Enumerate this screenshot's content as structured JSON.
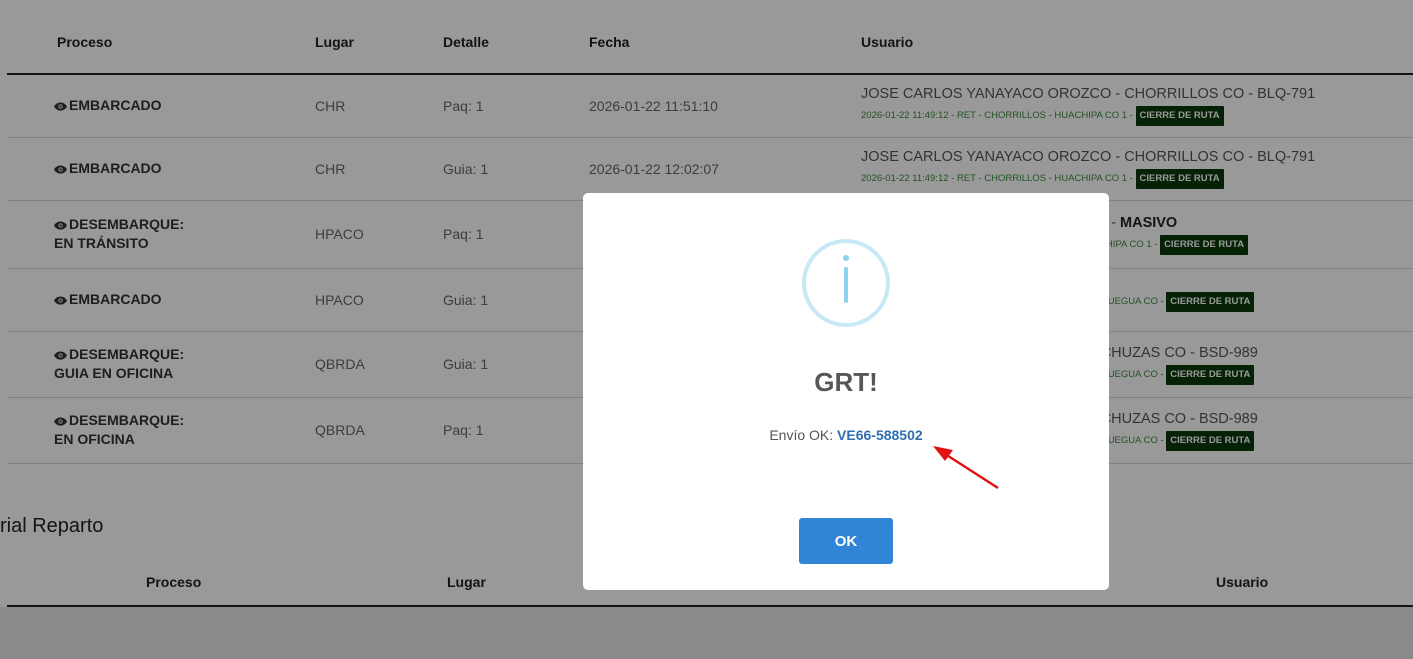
{
  "table": {
    "headers": {
      "proceso": "Proceso",
      "lugar": "Lugar",
      "detalle": "Detalle",
      "fecha": "Fecha",
      "usuario": "Usuario"
    },
    "rows": [
      {
        "proceso_line1": "EMBARCADO",
        "proceso_line2": "",
        "lugar": "CHR",
        "detalle": "Paq: 1",
        "fecha": "2026-01-22 11:51:10",
        "usuario": "JOSE CARLOS YANAYACO OROZCO - CHORRILLOS CO - BLQ-791",
        "usuario_bold": "",
        "sub": "2026-01-22 11:49:12 - RET - CHORRILLOS - HUACHIPA CO 1 - ",
        "badge": "CIERRE DE RUTA"
      },
      {
        "proceso_line1": "EMBARCADO",
        "proceso_line2": "",
        "lugar": "CHR",
        "detalle": "Guia: 1",
        "fecha": "2026-01-22 12:02:07",
        "usuario": "JOSE CARLOS YANAYACO OROZCO - CHORRILLOS CO - BLQ-791",
        "usuario_bold": "",
        "sub": "2026-01-22 11:49:12 - RET - CHORRILLOS - HUACHIPA CO 1 - ",
        "badge": "CIERRE DE RUTA"
      },
      {
        "proceso_line1": "DESEMBARQUE:",
        "proceso_line2": "EN TRÁNSITO",
        "lugar": "HPACO",
        "detalle": "Paq: 1",
        "fecha": "",
        "usuario": "91 - ",
        "usuario_bold": "MASIVO",
        "sub": "CHIPA CO 1 - ",
        "badge": "CIERRE DE RUTA"
      },
      {
        "proceso_line1": "EMBARCADO",
        "proceso_line2": "",
        "lugar": "HPACO",
        "detalle": "Guia: 1",
        "fecha": "",
        "usuario": "",
        "usuario_bold": "",
        "sub": "MOQUEGUA CO - ",
        "badge": "CIERRE DE RUTA"
      },
      {
        "proceso_line1": "DESEMBARQUE:",
        "proceso_line2": "GUIA EN OFICINA",
        "lugar": "QBRDA",
        "detalle": "Guia: 1",
        "fecha": "",
        "usuario": "ECHUZAS CO - BSD-989",
        "usuario_bold": "",
        "sub": "MOQUEGUA CO - ",
        "badge": "CIERRE DE RUTA"
      },
      {
        "proceso_line1": "DESEMBARQUE:",
        "proceso_line2": "EN OFICINA",
        "lugar": "QBRDA",
        "detalle": "Paq: 1",
        "fecha": "",
        "usuario": "ECHUZAS CO - BSD-989",
        "usuario_bold": "",
        "sub": "MOQUEGUA CO - ",
        "badge": "CIERRE DE RUTA"
      }
    ]
  },
  "section2": {
    "title": "rial Reparto",
    "headers": {
      "proceso": "Proceso",
      "lugar": "Lugar",
      "usuario": "Usuario"
    }
  },
  "modal": {
    "icon": "info-icon",
    "title": "GRT!",
    "text_prefix": "Envío OK: ",
    "link": "VE66-588502",
    "ok_label": "OK"
  },
  "colors": {
    "badge_bg": "#0b3a0b",
    "sub_text": "#3c8a3c",
    "link": "#2f6fb0",
    "ok_button": "#3085d6",
    "info_icon": "#8fd1ee",
    "arrow": "#e31212"
  }
}
